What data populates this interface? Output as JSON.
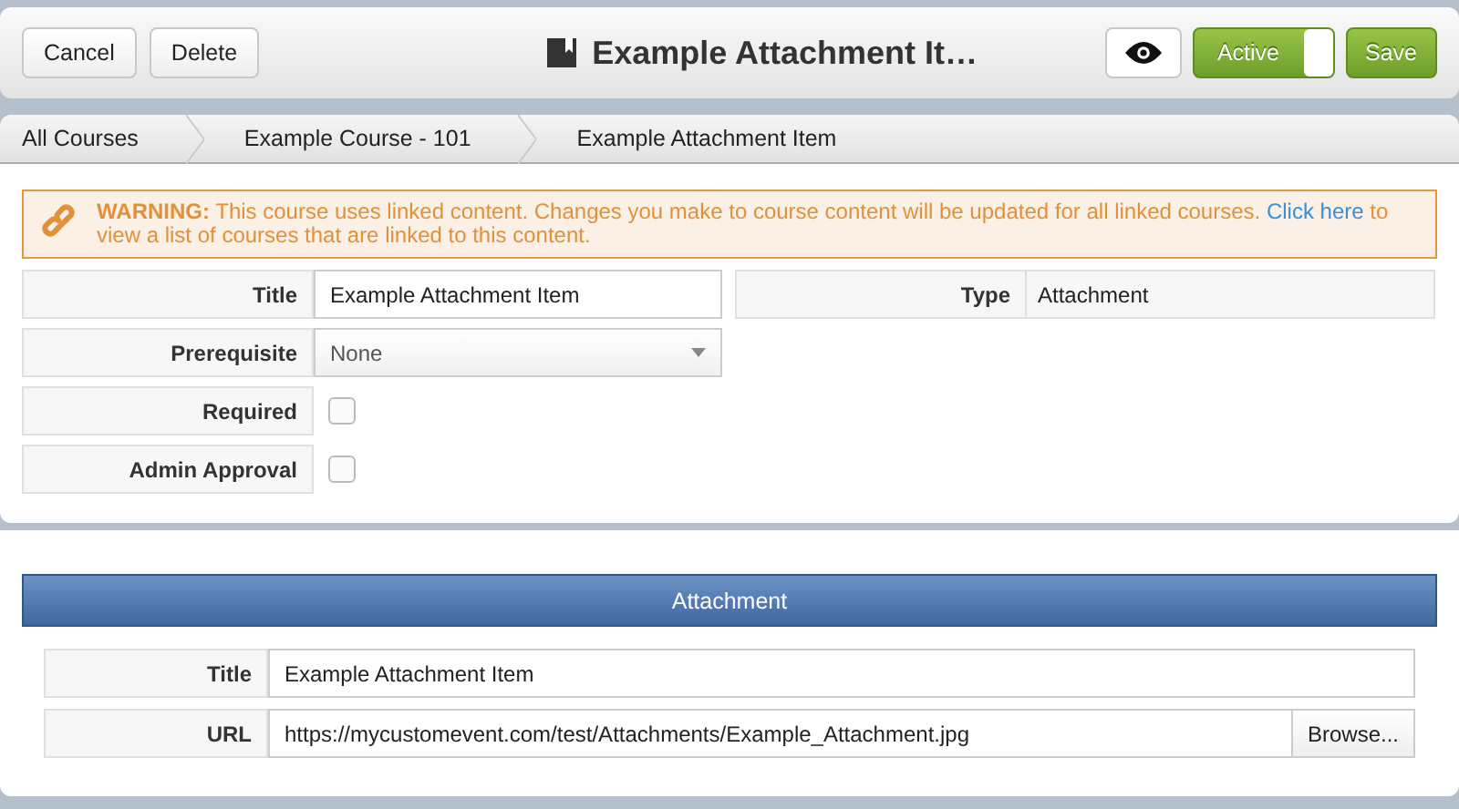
{
  "toolbar": {
    "buttons": [
      "Cancel",
      "Delete"
    ],
    "title": "Example Attachment It…",
    "status_toggle": {
      "label": "Active",
      "on": true
    },
    "save": "Save"
  },
  "breadcrumbs": [
    "All Courses",
    "Example Course - 101",
    "Example Attachment Item"
  ],
  "warning": {
    "label": "WARNING:",
    "text": "This course uses linked content. Changes you make to course content will be updated for all linked courses.",
    "link": "Click here",
    "after": "to view a list of courses that are linked to this content."
  },
  "form": {
    "title": {
      "label": "Title",
      "value": "Example Attachment Item"
    },
    "type": {
      "label": "Type",
      "value": "Attachment"
    },
    "prerequisite": {
      "label": "Prerequisite",
      "value": "None"
    },
    "checks": [
      {
        "label": "Required",
        "checked": false
      },
      {
        "label": "Admin Approval",
        "checked": false
      }
    ]
  },
  "attachment": {
    "header": "Attachment",
    "title": {
      "label": "Title",
      "value": "Example Attachment Item"
    },
    "url": {
      "label": "URL",
      "value": "https://mycustomevent.com/test/Attachments/Example_Attachment.jpg",
      "button": "Browse..."
    }
  }
}
